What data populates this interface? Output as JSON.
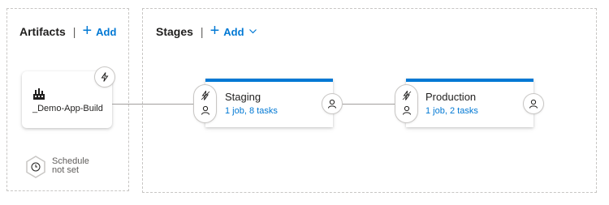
{
  "artifacts": {
    "title": "Artifacts",
    "separator": "|",
    "add_label": "Add",
    "card": {
      "name": "_Demo-App-Build",
      "icon": "build-pipeline-icon"
    },
    "trigger_icon": "lightning-icon",
    "schedule": {
      "icon": "clock-icon",
      "line1": "Schedule",
      "line2": "not set"
    }
  },
  "stages": {
    "title": "Stages",
    "separator": "|",
    "add_label": "Add",
    "items": [
      {
        "name": "Staging",
        "tasks": "1 job, 8 tasks"
      },
      {
        "name": "Production",
        "tasks": "1 job, 2 tasks"
      }
    ]
  },
  "colors": {
    "accent": "#0078d4",
    "border": "#c8c6c4",
    "text": "#201f1e"
  }
}
